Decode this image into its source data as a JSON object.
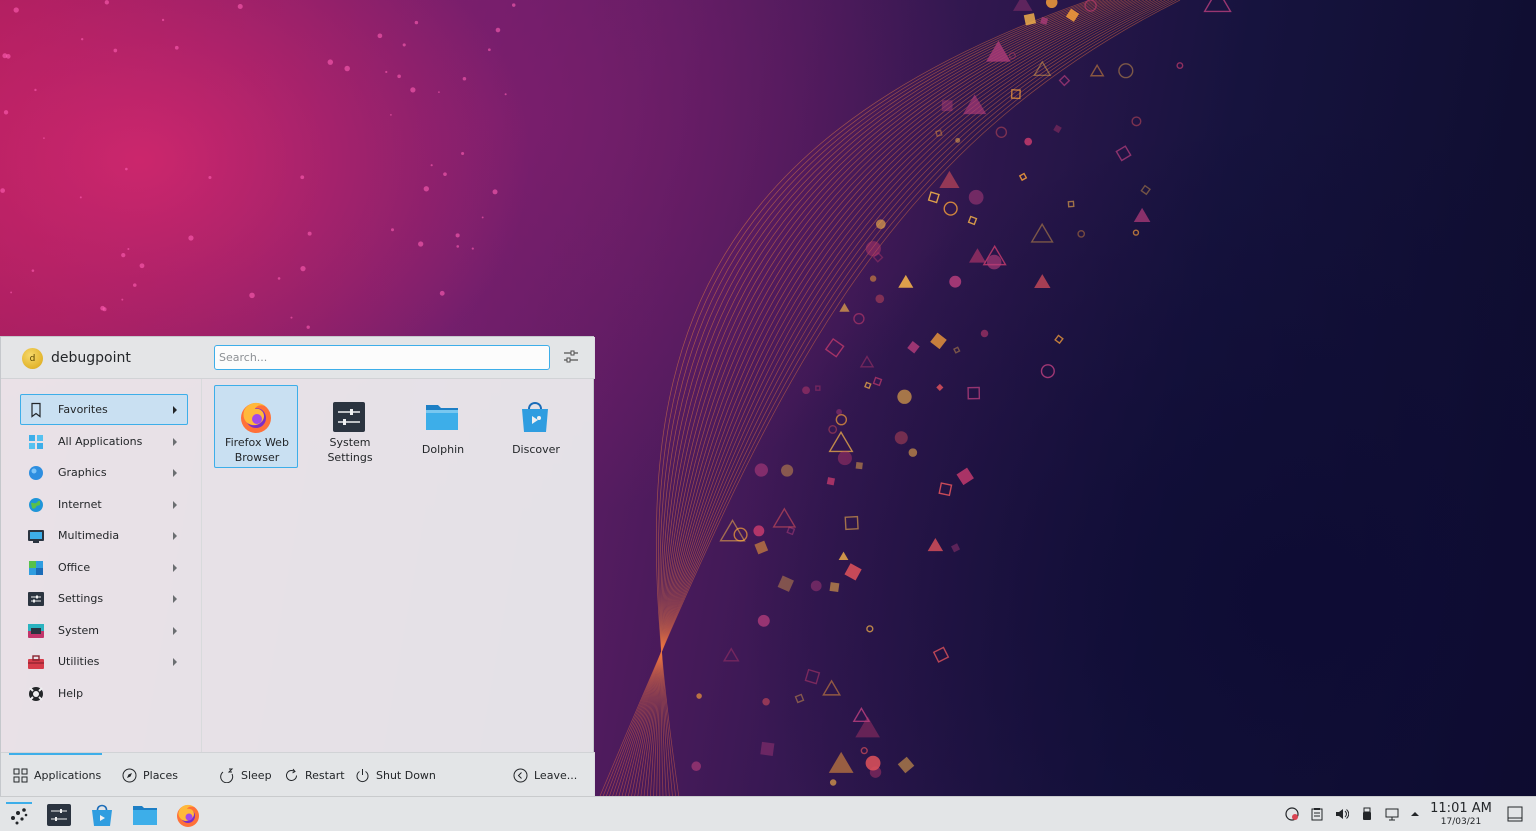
{
  "user": {
    "name": "debugpoint",
    "avatar_letter": "d"
  },
  "search": {
    "placeholder": "Search..."
  },
  "categories": [
    {
      "label": "Favorites",
      "icon": "bookmark-icon",
      "selected": true,
      "has_submenu": true
    },
    {
      "label": "All Applications",
      "icon": "grid-icon",
      "has_submenu": true
    },
    {
      "label": "Graphics",
      "icon": "graphics-icon",
      "has_submenu": true
    },
    {
      "label": "Internet",
      "icon": "globe-icon",
      "has_submenu": true
    },
    {
      "label": "Multimedia",
      "icon": "multimedia-icon",
      "has_submenu": true
    },
    {
      "label": "Office",
      "icon": "office-icon",
      "has_submenu": true
    },
    {
      "label": "Settings",
      "icon": "settings-icon",
      "has_submenu": true
    },
    {
      "label": "System",
      "icon": "system-icon",
      "has_submenu": true
    },
    {
      "label": "Utilities",
      "icon": "toolbox-icon",
      "has_submenu": true
    },
    {
      "label": "Help",
      "icon": "lifebuoy-icon",
      "has_submenu": false
    }
  ],
  "favorites": [
    {
      "name_line1": "Firefox Web",
      "name_line2": "Browser",
      "icon": "firefox-icon",
      "selected": true
    },
    {
      "name_line1": "System",
      "name_line2": "Settings",
      "icon": "system-settings-icon"
    },
    {
      "name_line1": "Dolphin",
      "name_line2": "",
      "icon": "folder-icon"
    },
    {
      "name_line1": "Discover",
      "name_line2": "",
      "icon": "discover-icon"
    }
  ],
  "footer": {
    "applications": "Applications",
    "places": "Places",
    "sleep": "Sleep",
    "restart": "Restart",
    "shutdown": "Shut Down",
    "leave": "Leave..."
  },
  "taskbar": {
    "pinned": [
      "launcher-icon",
      "system-settings-icon",
      "discover-icon",
      "dolphin-icon",
      "firefox-icon"
    ],
    "tray": [
      "update-icon",
      "clipboard-icon",
      "volume-icon",
      "usb-icon",
      "network-icon",
      "expand-arrow-icon"
    ],
    "time": "11:01 AM",
    "date": "17/03/21"
  },
  "colors": {
    "accent": "#3daee9",
    "selection": "#c9e0f2",
    "panel": "#e3e5e7"
  }
}
